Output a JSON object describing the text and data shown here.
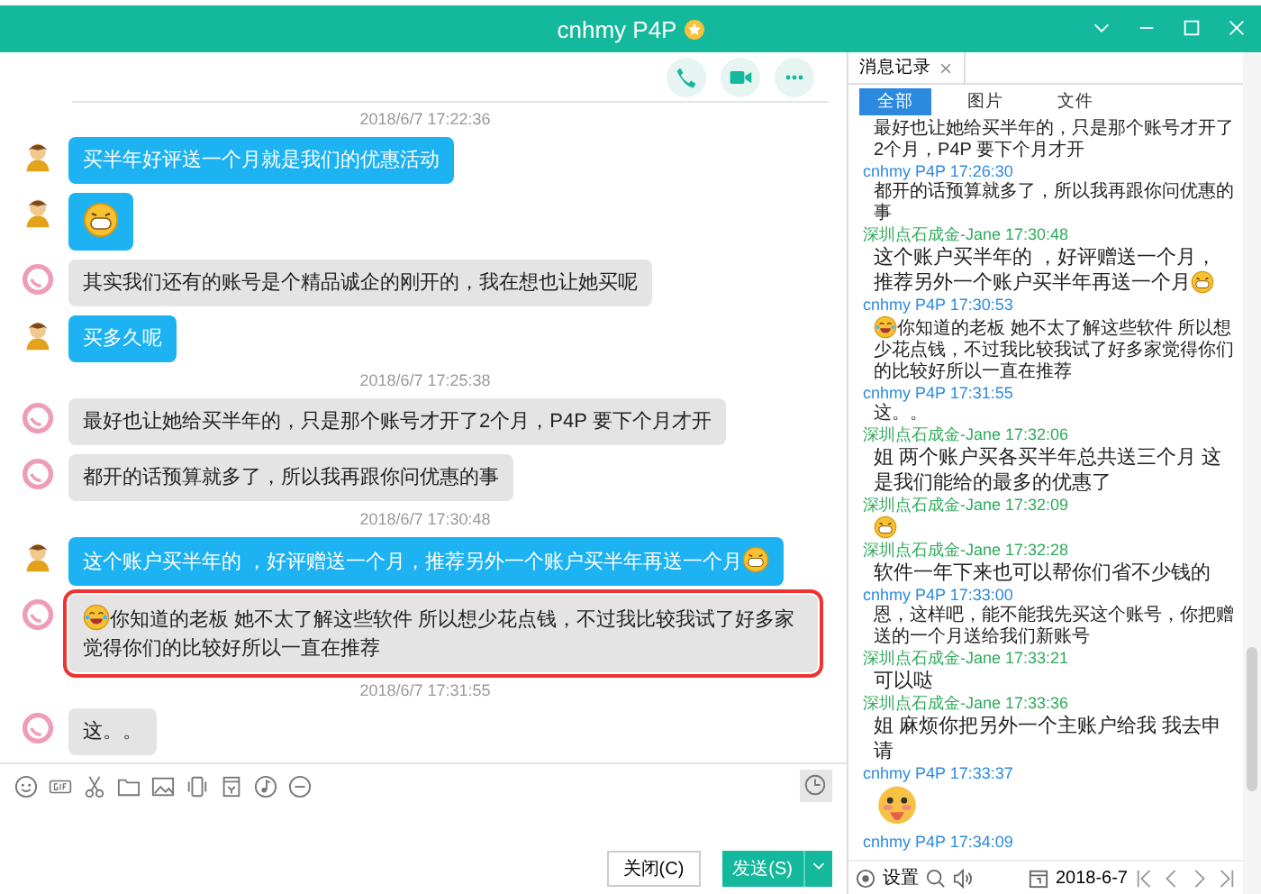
{
  "window": {
    "title": "cnhmy P4P"
  },
  "chat": [
    {
      "kind": "time",
      "text": "2018/6/7 17:22:36"
    },
    {
      "kind": "outgoing",
      "text": "买半年好评送一个月就是我们的优惠活动",
      "highlighted": false
    },
    {
      "kind": "outgoing",
      "emoji_start": {
        "kind": "grin"
      },
      "highlighted": false
    },
    {
      "kind": "incoming",
      "text": "其实我们还有的账号是个精品诚企的刚开的，我在想也让她买呢",
      "highlighted": false
    },
    {
      "kind": "outgoing",
      "text": "买多久呢",
      "highlighted": false
    },
    {
      "kind": "time",
      "text": "2018/6/7 17:25:38"
    },
    {
      "kind": "incoming",
      "text": "最好也让她给买半年的，只是那个账号才开了2个月，P4P 要下个月才开",
      "highlighted": false
    },
    {
      "kind": "incoming",
      "text": "都开的话预算就多了，所以我再跟你问优惠的事",
      "highlighted": false
    },
    {
      "kind": "time",
      "text": "2018/6/7 17:30:48"
    },
    {
      "kind": "outgoing",
      "text": "这个账户买半年的 ，好评赠送一个月，推荐另外一个账户买半年再送一个月",
      "emoji_end": {
        "kind": "grin"
      },
      "highlighted": false
    },
    {
      "kind": "incoming",
      "text": "你知道的老板 她不太了解这些软件 所以想少花点钱，不过我比较我试了好多家觉得你们的比较好所以一直在推荐",
      "emoji_start": {
        "kind": "laugh-cry"
      },
      "highlighted": true
    },
    {
      "kind": "time",
      "text": "2018/6/7 17:31:55"
    },
    {
      "kind": "incoming",
      "text": "这。。",
      "highlighted": false
    }
  ],
  "composer": {
    "buttons": [
      {
        "label": "关闭(C)",
        "kind": "plain"
      },
      {
        "label": "发送(S)",
        "kind": "primary"
      }
    ]
  },
  "history": {
    "tab": "消息记录",
    "filters": [
      {
        "label": "全部",
        "selected": true
      },
      {
        "label": "图片",
        "selected": false
      },
      {
        "label": "文件",
        "selected": false
      }
    ],
    "entries": [
      {
        "kind": "small",
        "text": "最好也让她给买半年的，只是那个账号才开了2个月，P4P 要下个月才开"
      },
      {
        "kind": "small",
        "color": "#2b8ae0",
        "header": "cnhmy P4P 17:26:30",
        "text": "都开的话预算就多了，所以我再跟你问优惠的事"
      },
      {
        "kind": "large",
        "color": "#2eaa5a",
        "header": "深圳点石成金-Jane 17:30:48",
        "text": "这个账户买半年的 ，好评赠送一个月，推荐另外一个账户买半年再送一个月",
        "emoji_end": {
          "kind": "grin"
        }
      },
      {
        "kind": "small",
        "color": "#2b8ae0",
        "header": "cnhmy P4P 17:30:53",
        "text": "你知道的老板 她不太了解这些软件 所以想少花点钱，不过我比较我试了好多家觉得你们的比较好所以一直在推荐",
        "emoji_start": {
          "kind": "laugh-cry"
        }
      },
      {
        "kind": "small",
        "color": "#2b8ae0",
        "header": "cnhmy P4P 17:31:55",
        "text": "这。。"
      },
      {
        "kind": "large",
        "color": "#2eaa5a",
        "header": "深圳点石成金-Jane 17:32:06",
        "text": "姐 两个账户买各买半年总共送三个月 这是我们能给的最多的优惠了"
      },
      {
        "kind": "large",
        "color": "#2eaa5a",
        "header": "深圳点石成金-Jane 17:32:09",
        "emoji_start": {
          "kind": "grin"
        }
      },
      {
        "kind": "large",
        "color": "#2eaa5a",
        "header": "深圳点石成金-Jane 17:32:28",
        "text": "软件一年下来也可以帮你们省不少钱的"
      },
      {
        "kind": "small",
        "color": "#2b8ae0",
        "header": "cnhmy P4P 17:33:00",
        "text": "恩，这样吧，能不能我先买这个账号，你把赠送的一个月送给我们新账号"
      },
      {
        "kind": "large",
        "color": "#2eaa5a",
        "header": "深圳点石成金-Jane 17:33:21",
        "text": "可以哒"
      },
      {
        "kind": "large",
        "color": "#2eaa5a",
        "header": "深圳点石成金-Jane 17:33:36",
        "text": "姐 麻烦你把另外一个主账户给我 我去申请"
      },
      {
        "kind": "large",
        "color": "#2b8ae0",
        "header": "cnhmy P4P 17:33:37",
        "emoji_start": {
          "kind": "blush"
        }
      },
      {
        "color": "#2b8ae0",
        "header": "cnhmy P4P 17:34:09"
      }
    ],
    "footer": {
      "settings": "设置",
      "date": "2018-6-7"
    }
  }
}
